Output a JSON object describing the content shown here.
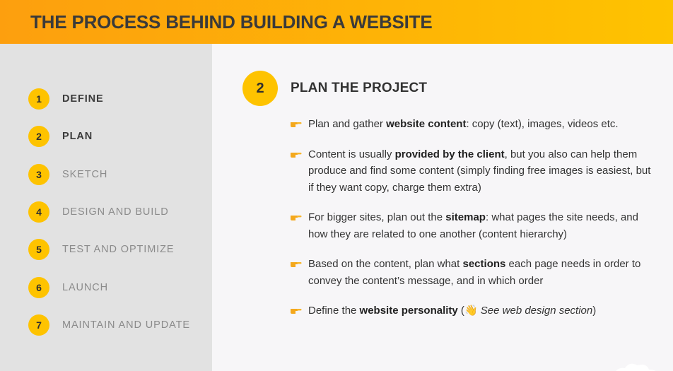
{
  "header": {
    "title_pre": "THE ",
    "title_bold": "PROCESS",
    "title_post": " BEHIND BUILDING A WEBSITE"
  },
  "sidebar": {
    "steps": [
      {
        "num": "1",
        "label": "DEFINE",
        "active": true
      },
      {
        "num": "2",
        "label": "PLAN",
        "active": true
      },
      {
        "num": "3",
        "label": "SKETCH",
        "active": false
      },
      {
        "num": "4",
        "label": "DESIGN AND BUILD",
        "active": false
      },
      {
        "num": "5",
        "label": "TEST AND OPTIMIZE",
        "active": false
      },
      {
        "num": "6",
        "label": "LAUNCH",
        "active": false
      },
      {
        "num": "7",
        "label": "MAINTAIN AND UPDATE",
        "active": false
      }
    ]
  },
  "main": {
    "step_num": "2",
    "title": "PLAN THE PROJECT",
    "bullets": {
      "b1": {
        "t1": "Plan and gather ",
        "b1": "website content",
        "t2": ": copy (text), images, videos etc."
      },
      "b2": {
        "t1": "Content is usually ",
        "b1": "provided by the client",
        "t2": ", but you also can help them produce and find some content (simply finding free images is easiest, but if they want copy, charge them extra)"
      },
      "b3": {
        "t1": "For bigger sites, plan out the ",
        "b1": "sitemap",
        "t2": ": what pages the site needs, and how they are related to one another (content hierarchy)"
      },
      "b4": {
        "t1": "Based on the content, plan what ",
        "b1": "sections",
        "t2": " each page needs in order to convey the content’s message, and in which order"
      },
      "b5": {
        "t1": "Define the ",
        "b1": "website personality",
        "t2": " (",
        "emoji": "👋",
        "i1": " See web design section",
        "t3": ")"
      }
    }
  },
  "colors": {
    "accent": "#fec300",
    "header_start": "#fd9f0e",
    "sidebar_bg": "#e2e2e2",
    "main_bg": "#f7f6f8"
  },
  "icons": {
    "bullet": "pointing-hand-icon"
  }
}
